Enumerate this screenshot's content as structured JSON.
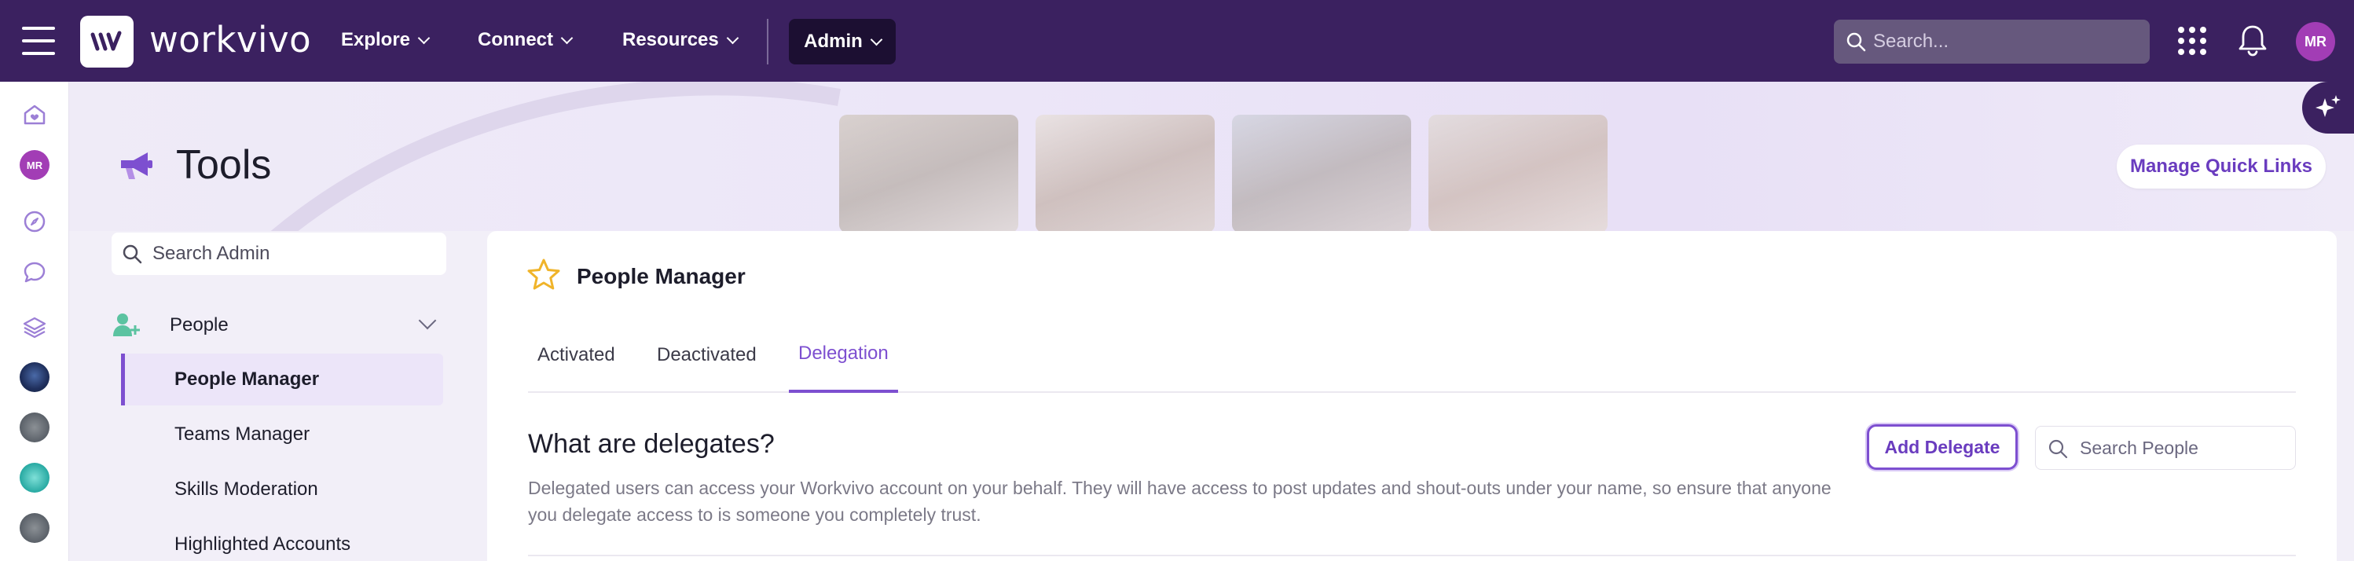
{
  "topbar": {
    "brand": "workvivo",
    "nav": [
      {
        "label": "Explore"
      },
      {
        "label": "Connect"
      },
      {
        "label": "Resources"
      }
    ],
    "admin_label": "Admin",
    "search_placeholder": "Search...",
    "avatar_initials": "MR"
  },
  "rail": {
    "avatar_initials": "MR"
  },
  "page": {
    "title": "Tools",
    "quick_links_label": "Manage Quick Links"
  },
  "sidebar": {
    "search_placeholder": "Search Admin",
    "group_label": "People",
    "items": [
      {
        "label": "People Manager",
        "active": true
      },
      {
        "label": "Teams Manager",
        "active": false
      },
      {
        "label": "Skills Moderation",
        "active": false
      },
      {
        "label": "Highlighted Accounts",
        "active": false
      }
    ]
  },
  "card": {
    "title": "People Manager",
    "tabs": [
      {
        "label": "Activated"
      },
      {
        "label": "Deactivated"
      },
      {
        "label": "Delegation",
        "active": true
      }
    ],
    "section_title": "What are delegates?",
    "section_desc": "Delegated users can access your Workvivo account on your behalf. They will have access to post updates and shout-outs under your name, so ensure that anyone you delegate access to is someone you completely trust.",
    "add_delegate_label": "Add Delegate",
    "search_people_placeholder": "Search People"
  },
  "colors": {
    "topbar": "#3b2160",
    "accent": "#7d4fd0",
    "avatar": "#a23db5"
  }
}
